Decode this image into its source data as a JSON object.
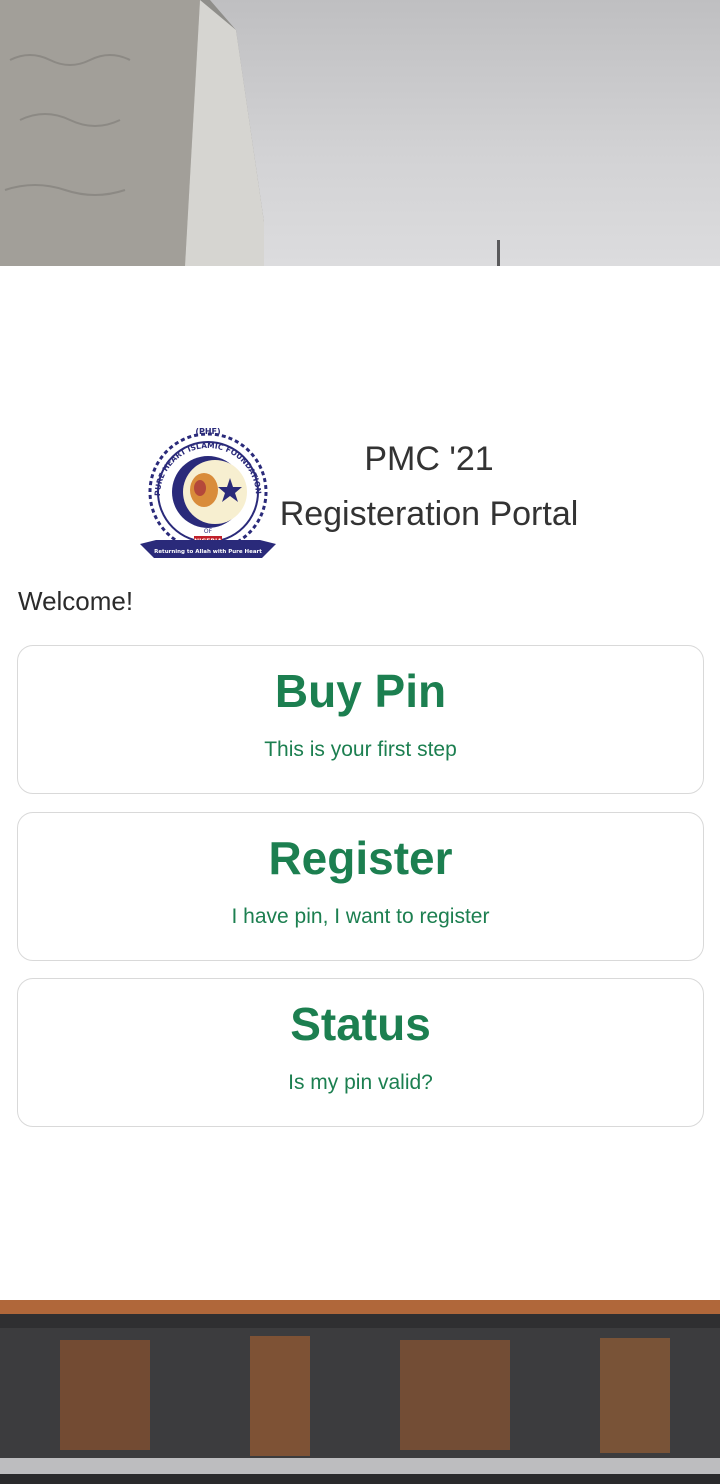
{
  "header": {
    "title_line1": "PMC '21",
    "title_line2": "Registeration Portal",
    "logo": {
      "acronym": "(PHF)",
      "ring_text": "PURE HEART ISLAMIC FOUNDATION",
      "of": "OF",
      "country": "NIGERIA",
      "motto": "Returning to Allah with Pure Heart"
    }
  },
  "welcome": "Welcome!",
  "cards": [
    {
      "title": "Buy Pin",
      "subtitle": "This is your first step"
    },
    {
      "title": "Register",
      "subtitle": "I have pin, I want to register"
    },
    {
      "title": "Status",
      "subtitle": "Is my pin valid?"
    }
  ],
  "colors": {
    "accent": "#1c7f50",
    "text": "#333333",
    "card_border": "#d9d9d9",
    "logo_navy": "#2a2a7a"
  }
}
